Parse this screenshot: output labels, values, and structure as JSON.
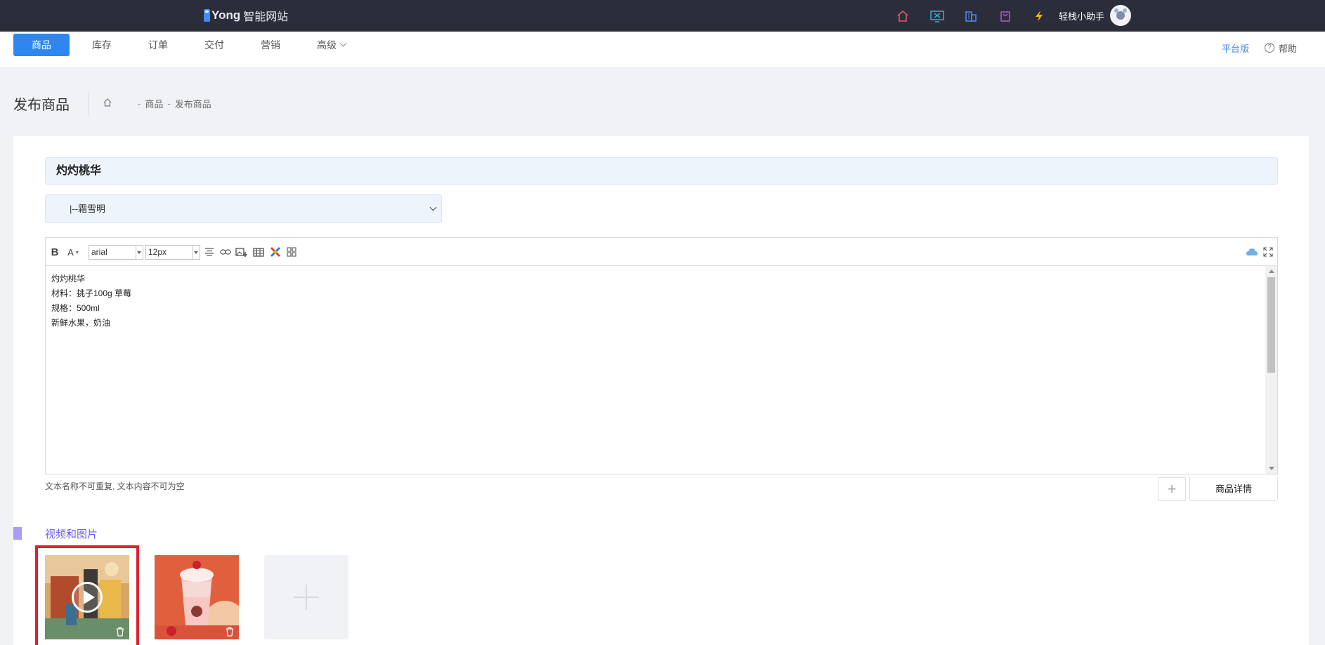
{
  "topbar": {
    "logo_i": "i",
    "logo_text": "Yong",
    "logo_sub": "智能网站",
    "icons": [
      "home-icon",
      "monitor-icon",
      "building-icon",
      "bag-icon",
      "lightning-icon"
    ],
    "icon_colors": [
      "#e8556b",
      "#2bb6c9",
      "#4a8ef4",
      "#b05cd8",
      "#f5b01b"
    ],
    "user_name": "轻栈小助手"
  },
  "nav": {
    "tabs": [
      {
        "label": "商品",
        "active": true
      },
      {
        "label": "库存"
      },
      {
        "label": "订单"
      },
      {
        "label": "交付"
      },
      {
        "label": "营销"
      },
      {
        "label": "高级",
        "has_dropdown": true
      }
    ],
    "platform_label": "平台版",
    "help_label": "帮助",
    "accent_color": "#2e86f0"
  },
  "page": {
    "title": "发布商品",
    "breadcrumb": [
      "商品",
      "发布商品"
    ],
    "breadcrumb_sep": "-"
  },
  "form": {
    "product_name": "灼灼桃华",
    "category_selected": "|--霜雪明",
    "editor": {
      "font_family": "arial",
      "font_size": "12px",
      "content_lines": [
        "灼灼桃华",
        "材料：挑子100g 草莓",
        "规格：500ml",
        "新鲜水果，奶油"
      ]
    },
    "hint": "文本名称不可重复, 文本内容不可为空",
    "add_tab_label": "+",
    "detail_tab_label": "商品详情"
  },
  "media": {
    "section_title": "视频和图片",
    "items": [
      {
        "type": "video",
        "selected": true
      },
      {
        "type": "image"
      }
    ]
  }
}
